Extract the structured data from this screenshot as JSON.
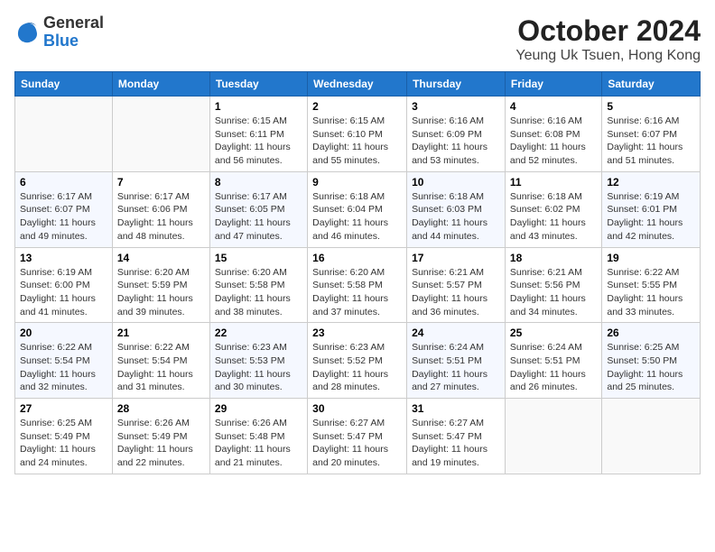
{
  "header": {
    "logo": {
      "general": "General",
      "blue": "Blue"
    },
    "title": "October 2024",
    "location": "Yeung Uk Tsuen, Hong Kong"
  },
  "weekdays": [
    "Sunday",
    "Monday",
    "Tuesday",
    "Wednesday",
    "Thursday",
    "Friday",
    "Saturday"
  ],
  "weeks": [
    [
      {
        "day": "",
        "sunrise": "",
        "sunset": "",
        "daylight": ""
      },
      {
        "day": "",
        "sunrise": "",
        "sunset": "",
        "daylight": ""
      },
      {
        "day": "1",
        "sunrise": "Sunrise: 6:15 AM",
        "sunset": "Sunset: 6:11 PM",
        "daylight": "Daylight: 11 hours and 56 minutes."
      },
      {
        "day": "2",
        "sunrise": "Sunrise: 6:15 AM",
        "sunset": "Sunset: 6:10 PM",
        "daylight": "Daylight: 11 hours and 55 minutes."
      },
      {
        "day": "3",
        "sunrise": "Sunrise: 6:16 AM",
        "sunset": "Sunset: 6:09 PM",
        "daylight": "Daylight: 11 hours and 53 minutes."
      },
      {
        "day": "4",
        "sunrise": "Sunrise: 6:16 AM",
        "sunset": "Sunset: 6:08 PM",
        "daylight": "Daylight: 11 hours and 52 minutes."
      },
      {
        "day": "5",
        "sunrise": "Sunrise: 6:16 AM",
        "sunset": "Sunset: 6:07 PM",
        "daylight": "Daylight: 11 hours and 51 minutes."
      }
    ],
    [
      {
        "day": "6",
        "sunrise": "Sunrise: 6:17 AM",
        "sunset": "Sunset: 6:07 PM",
        "daylight": "Daylight: 11 hours and 49 minutes."
      },
      {
        "day": "7",
        "sunrise": "Sunrise: 6:17 AM",
        "sunset": "Sunset: 6:06 PM",
        "daylight": "Daylight: 11 hours and 48 minutes."
      },
      {
        "day": "8",
        "sunrise": "Sunrise: 6:17 AM",
        "sunset": "Sunset: 6:05 PM",
        "daylight": "Daylight: 11 hours and 47 minutes."
      },
      {
        "day": "9",
        "sunrise": "Sunrise: 6:18 AM",
        "sunset": "Sunset: 6:04 PM",
        "daylight": "Daylight: 11 hours and 46 minutes."
      },
      {
        "day": "10",
        "sunrise": "Sunrise: 6:18 AM",
        "sunset": "Sunset: 6:03 PM",
        "daylight": "Daylight: 11 hours and 44 minutes."
      },
      {
        "day": "11",
        "sunrise": "Sunrise: 6:18 AM",
        "sunset": "Sunset: 6:02 PM",
        "daylight": "Daylight: 11 hours and 43 minutes."
      },
      {
        "day": "12",
        "sunrise": "Sunrise: 6:19 AM",
        "sunset": "Sunset: 6:01 PM",
        "daylight": "Daylight: 11 hours and 42 minutes."
      }
    ],
    [
      {
        "day": "13",
        "sunrise": "Sunrise: 6:19 AM",
        "sunset": "Sunset: 6:00 PM",
        "daylight": "Daylight: 11 hours and 41 minutes."
      },
      {
        "day": "14",
        "sunrise": "Sunrise: 6:20 AM",
        "sunset": "Sunset: 5:59 PM",
        "daylight": "Daylight: 11 hours and 39 minutes."
      },
      {
        "day": "15",
        "sunrise": "Sunrise: 6:20 AM",
        "sunset": "Sunset: 5:58 PM",
        "daylight": "Daylight: 11 hours and 38 minutes."
      },
      {
        "day": "16",
        "sunrise": "Sunrise: 6:20 AM",
        "sunset": "Sunset: 5:58 PM",
        "daylight": "Daylight: 11 hours and 37 minutes."
      },
      {
        "day": "17",
        "sunrise": "Sunrise: 6:21 AM",
        "sunset": "Sunset: 5:57 PM",
        "daylight": "Daylight: 11 hours and 36 minutes."
      },
      {
        "day": "18",
        "sunrise": "Sunrise: 6:21 AM",
        "sunset": "Sunset: 5:56 PM",
        "daylight": "Daylight: 11 hours and 34 minutes."
      },
      {
        "day": "19",
        "sunrise": "Sunrise: 6:22 AM",
        "sunset": "Sunset: 5:55 PM",
        "daylight": "Daylight: 11 hours and 33 minutes."
      }
    ],
    [
      {
        "day": "20",
        "sunrise": "Sunrise: 6:22 AM",
        "sunset": "Sunset: 5:54 PM",
        "daylight": "Daylight: 11 hours and 32 minutes."
      },
      {
        "day": "21",
        "sunrise": "Sunrise: 6:22 AM",
        "sunset": "Sunset: 5:54 PM",
        "daylight": "Daylight: 11 hours and 31 minutes."
      },
      {
        "day": "22",
        "sunrise": "Sunrise: 6:23 AM",
        "sunset": "Sunset: 5:53 PM",
        "daylight": "Daylight: 11 hours and 30 minutes."
      },
      {
        "day": "23",
        "sunrise": "Sunrise: 6:23 AM",
        "sunset": "Sunset: 5:52 PM",
        "daylight": "Daylight: 11 hours and 28 minutes."
      },
      {
        "day": "24",
        "sunrise": "Sunrise: 6:24 AM",
        "sunset": "Sunset: 5:51 PM",
        "daylight": "Daylight: 11 hours and 27 minutes."
      },
      {
        "day": "25",
        "sunrise": "Sunrise: 6:24 AM",
        "sunset": "Sunset: 5:51 PM",
        "daylight": "Daylight: 11 hours and 26 minutes."
      },
      {
        "day": "26",
        "sunrise": "Sunrise: 6:25 AM",
        "sunset": "Sunset: 5:50 PM",
        "daylight": "Daylight: 11 hours and 25 minutes."
      }
    ],
    [
      {
        "day": "27",
        "sunrise": "Sunrise: 6:25 AM",
        "sunset": "Sunset: 5:49 PM",
        "daylight": "Daylight: 11 hours and 24 minutes."
      },
      {
        "day": "28",
        "sunrise": "Sunrise: 6:26 AM",
        "sunset": "Sunset: 5:49 PM",
        "daylight": "Daylight: 11 hours and 22 minutes."
      },
      {
        "day": "29",
        "sunrise": "Sunrise: 6:26 AM",
        "sunset": "Sunset: 5:48 PM",
        "daylight": "Daylight: 11 hours and 21 minutes."
      },
      {
        "day": "30",
        "sunrise": "Sunrise: 6:27 AM",
        "sunset": "Sunset: 5:47 PM",
        "daylight": "Daylight: 11 hours and 20 minutes."
      },
      {
        "day": "31",
        "sunrise": "Sunrise: 6:27 AM",
        "sunset": "Sunset: 5:47 PM",
        "daylight": "Daylight: 11 hours and 19 minutes."
      },
      {
        "day": "",
        "sunrise": "",
        "sunset": "",
        "daylight": ""
      },
      {
        "day": "",
        "sunrise": "",
        "sunset": "",
        "daylight": ""
      }
    ]
  ]
}
